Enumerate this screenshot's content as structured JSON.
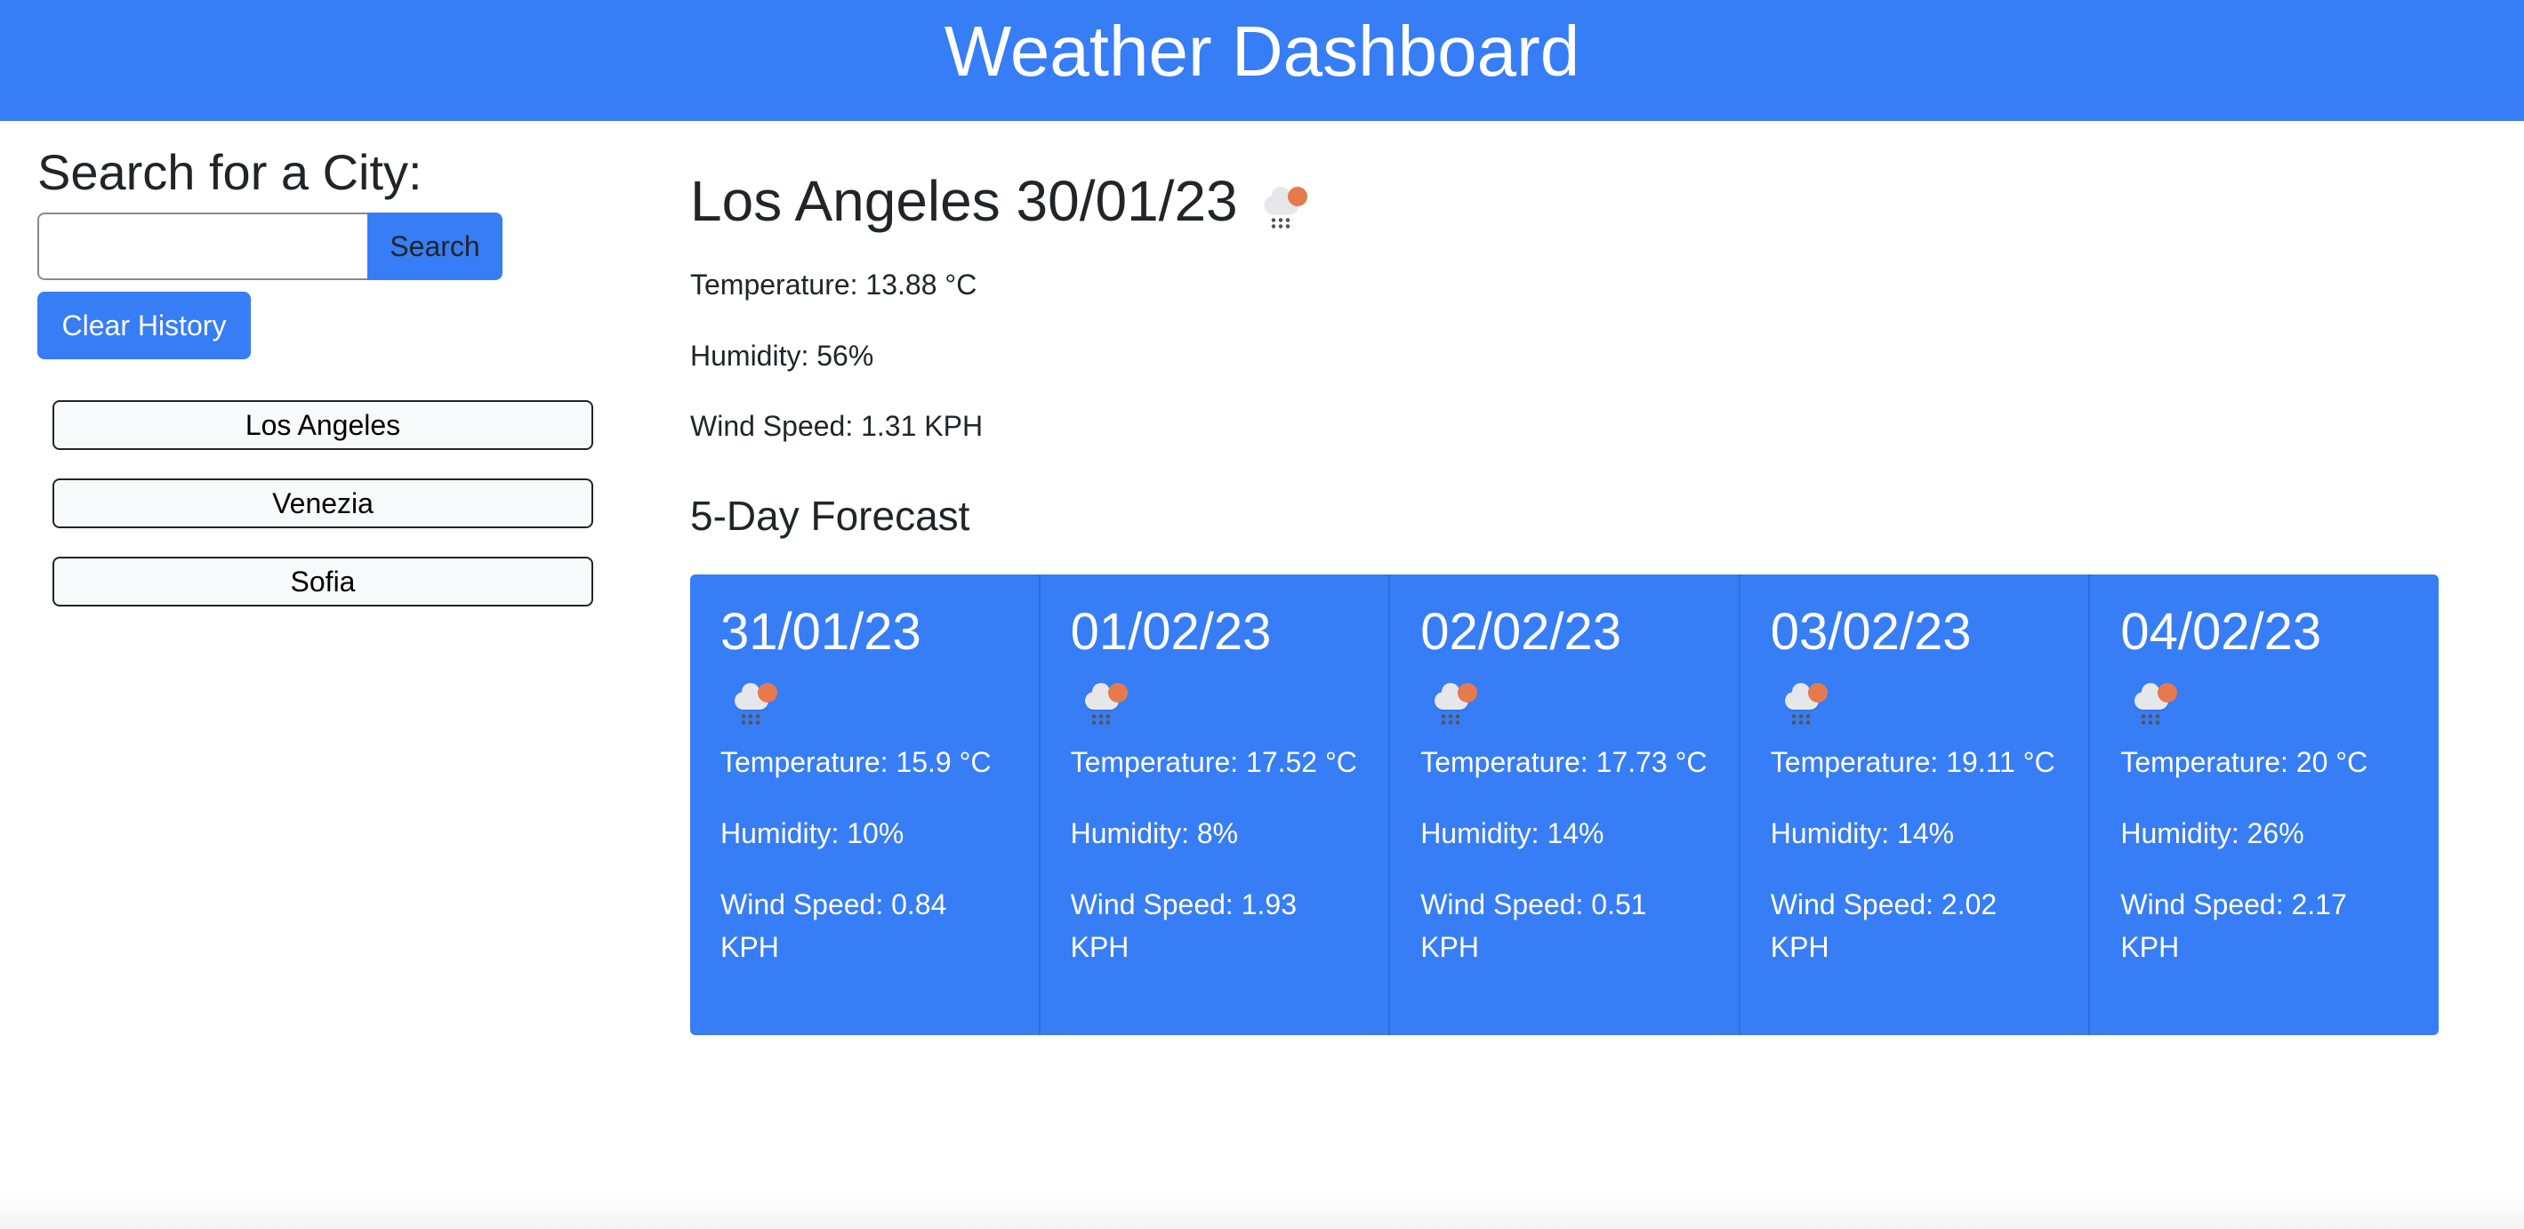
{
  "header": {
    "title": "Weather Dashboard"
  },
  "sidebar": {
    "search_title": "Search for a City:",
    "search_input_value": "",
    "search_placeholder": "",
    "search_button": "Search",
    "clear_button": "Clear History",
    "history": [
      "Los Angeles",
      "Venezia",
      "Sofia"
    ]
  },
  "current": {
    "city_date": "Los Angeles 30/01/23",
    "icon": "cloud-rain-sun-icon",
    "temperature": "Temperature: 13.88 °C",
    "humidity": "Humidity: 56%",
    "wind": "Wind Speed: 1.31 KPH"
  },
  "forecast": {
    "title": "5-Day Forecast",
    "days": [
      {
        "date": "31/01/23",
        "icon": "cloud-rain-sun-icon",
        "temperature": "Temperature: 15.9 °C",
        "humidity": "Humidity: 10%",
        "wind": "Wind Speed: 0.84 KPH"
      },
      {
        "date": "01/02/23",
        "icon": "cloud-rain-sun-icon",
        "temperature": "Temperature: 17.52 °C",
        "humidity": "Humidity: 8%",
        "wind": "Wind Speed: 1.93 KPH"
      },
      {
        "date": "02/02/23",
        "icon": "cloud-rain-sun-icon",
        "temperature": "Temperature: 17.73 °C",
        "humidity": "Humidity: 14%",
        "wind": "Wind Speed: 0.51 KPH"
      },
      {
        "date": "03/02/23",
        "icon": "cloud-rain-sun-icon",
        "temperature": "Temperature: 19.11 °C",
        "humidity": "Humidity: 14%",
        "wind": "Wind Speed: 2.02 KPH"
      },
      {
        "date": "04/02/23",
        "icon": "cloud-rain-sun-icon",
        "temperature": "Temperature: 20 °C",
        "humidity": "Humidity: 26%",
        "wind": "Wind Speed: 2.17 KPH"
      }
    ]
  },
  "colors": {
    "accent": "#377df5",
    "card_border": "#2c6ddd"
  }
}
